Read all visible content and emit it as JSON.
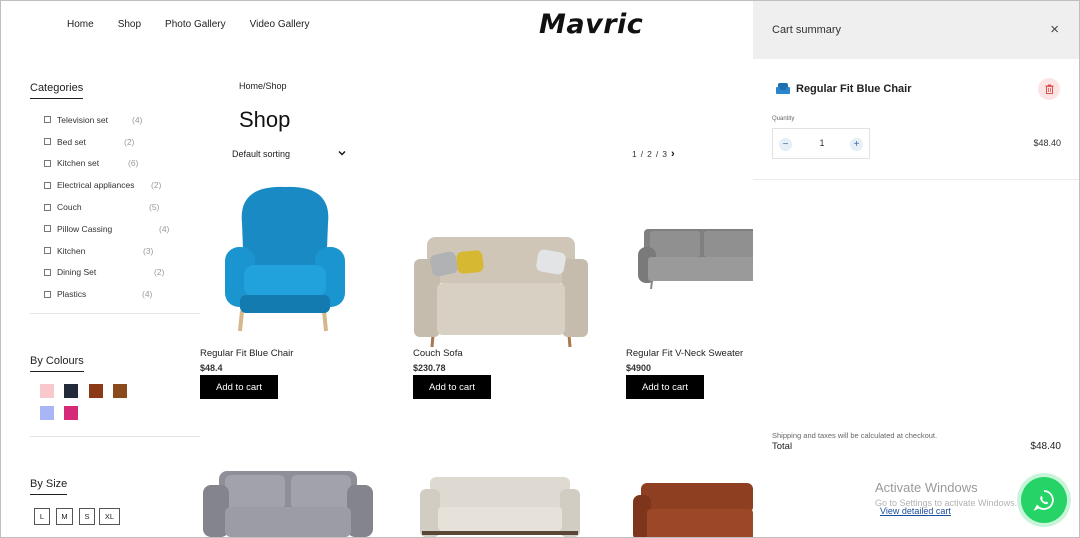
{
  "brand": "Mavric",
  "nav": [
    "Home",
    "Shop",
    "Photo Gallery",
    "Video Gallery"
  ],
  "sidebar": {
    "categories_title": "Categories",
    "categories": [
      {
        "label": "Television set",
        "count": "(4)"
      },
      {
        "label": "Bed set",
        "count": "(2)"
      },
      {
        "label": "Kitchen set",
        "count": "(6)"
      },
      {
        "label": "Electrical appliances",
        "count": "(2)"
      },
      {
        "label": "Couch",
        "count": "(5)"
      },
      {
        "label": "Pillow Cassing",
        "count": "(4)"
      },
      {
        "label": "Kitchen",
        "count": "(3)"
      },
      {
        "label": "Dining Set",
        "count": "(2)"
      },
      {
        "label": "Plastics",
        "count": "(4)"
      }
    ],
    "colours_title": "By Colours",
    "colours": [
      "#f8c8cc",
      "#232b3a",
      "#8a3a17",
      "#8a4a1c",
      "#a9b6f6",
      "#d42a78"
    ],
    "size_title": "By Size",
    "sizes": [
      "L",
      "M",
      "S",
      "XL"
    ]
  },
  "main": {
    "breadcrumb": "Home/Shop",
    "title": "Shop",
    "sorting": "Default sorting",
    "pagination": {
      "pages": [
        "1",
        "2",
        "3"
      ],
      "separator": "/"
    },
    "products": [
      {
        "name": "Regular Fit Blue Chair",
        "price": "$48.4",
        "button": "Add to cart",
        "image": "blue-armchair"
      },
      {
        "name": "Couch Sofa",
        "price": "$230.78",
        "button": "Add to cart",
        "image": "beige-sofa"
      },
      {
        "name": "Regular Fit V-Neck Sweater",
        "price": "$4900",
        "button": "Add to cart",
        "image": "grey-sofa"
      }
    ],
    "row2_images": [
      "grey-sofa-2",
      "cream-sofa",
      "brown-leather-sofa"
    ]
  },
  "cart": {
    "title": "Cart summary",
    "item": {
      "name": "Regular Fit Blue Chair",
      "quantity_label": "Quantity",
      "quantity": "1",
      "price": "$48.40"
    },
    "shipping_note": "Shipping and taxes will be calculated at checkout.",
    "total_label": "Total",
    "total": "$48.40",
    "view_cart": "View detailed cart"
  },
  "overlay": {
    "activate_title": "Activate Windows",
    "activate_sub": "Go to Settings to activate Windows."
  },
  "colors": {
    "accent": "#000000",
    "whatsapp": "#25d366",
    "cart_header": "#efefef"
  }
}
